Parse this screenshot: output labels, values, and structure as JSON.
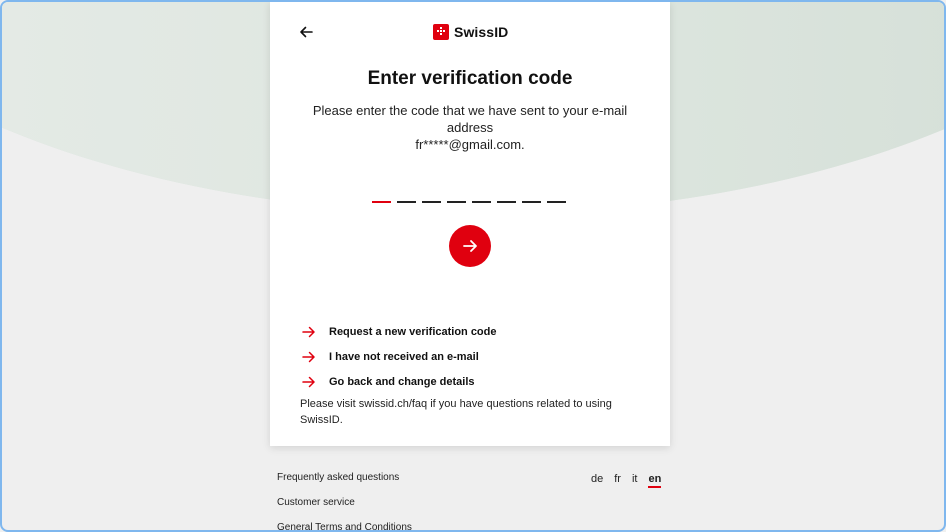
{
  "header": {
    "brand": "SwissID"
  },
  "main": {
    "title": "Enter verification code",
    "description_line1": "Please enter the code that we have sent to your e-mail address",
    "description_line2": "fr*****@gmail.com.",
    "code_length": 8,
    "active_slot_index": 0
  },
  "links": {
    "request_new_code": "Request a new verification code",
    "not_received": "I have not received an e-mail",
    "go_back": "Go back and change details"
  },
  "faq_note": "Please visit swissid.ch/faq if you have questions related to using SwissID.",
  "footer": {
    "faq": "Frequently asked questions",
    "customer_service": "Customer service",
    "terms": "General Terms and Conditions"
  },
  "languages": [
    "de",
    "fr",
    "it",
    "en"
  ],
  "selected_language": "en",
  "colors": {
    "accent": "#e0000f",
    "background_curve": "#d9e3dc"
  }
}
